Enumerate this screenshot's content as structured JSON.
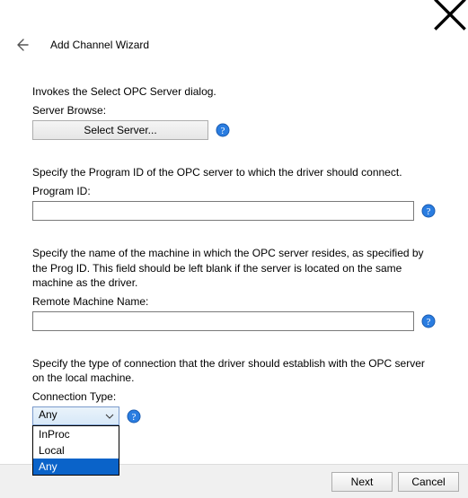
{
  "window": {
    "title": "Add Channel Wizard"
  },
  "sections": {
    "serverBrowse": {
      "desc": "Invokes the Select OPC Server dialog.",
      "label": "Server Browse:",
      "button": "Select Server..."
    },
    "programId": {
      "desc": "Specify the Program ID of the OPC server to which the driver should connect.",
      "label": "Program ID:",
      "value": ""
    },
    "remoteMachine": {
      "desc": "Specify the name of the machine in which the OPC server resides, as specified by the Prog ID. This field should be left blank if the server is located on the same machine as the driver.",
      "label": "Remote Machine Name:",
      "value": ""
    },
    "connectionType": {
      "desc": "Specify the type of connection that the driver should establish with the OPC server on the local machine.",
      "label": "Connection Type:",
      "selected": "Any",
      "options": [
        "InProc",
        "Local",
        "Any"
      ]
    }
  },
  "footer": {
    "next": "Next",
    "cancel": "Cancel"
  }
}
